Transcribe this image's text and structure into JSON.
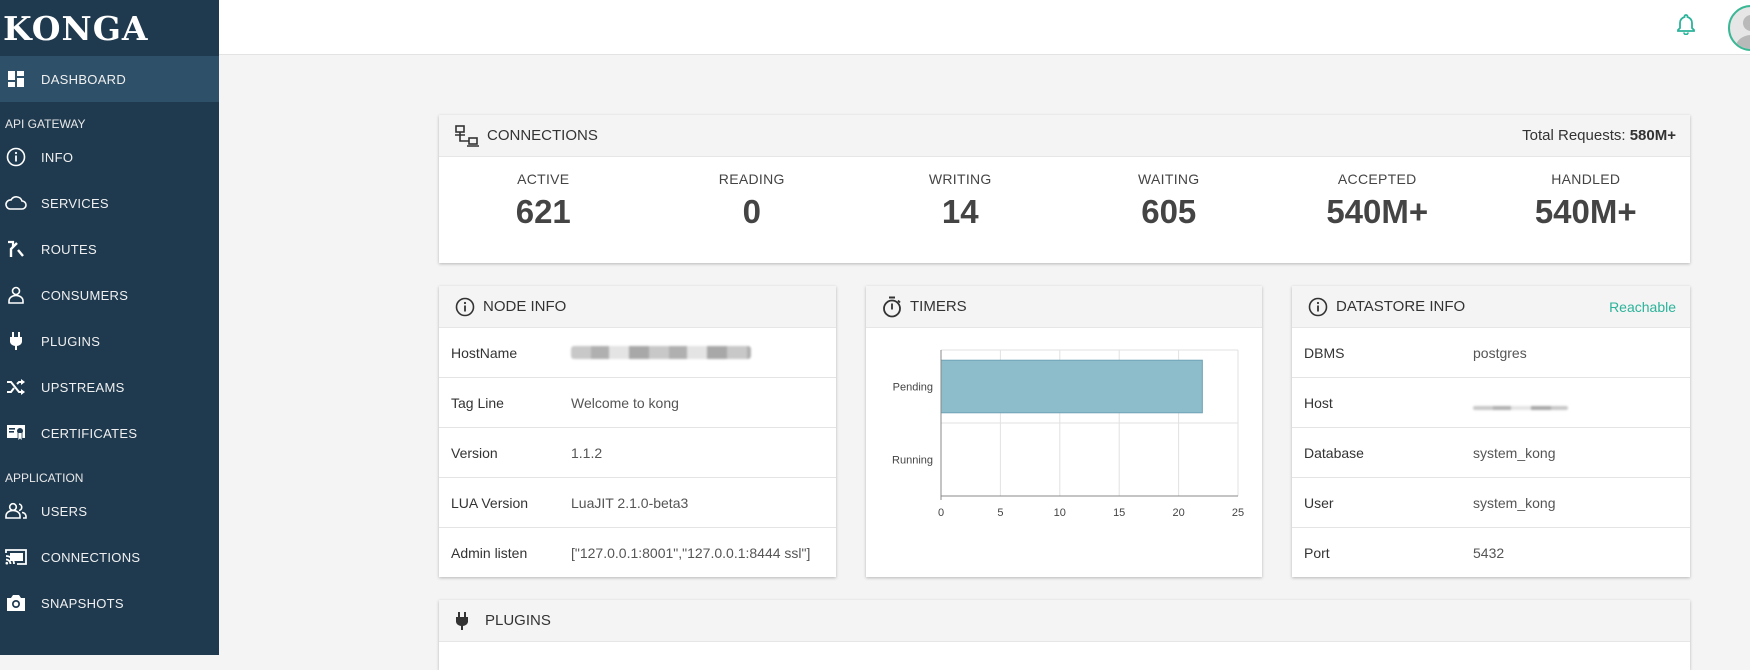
{
  "app": {
    "logo": "KONGA"
  },
  "sidebar": {
    "dashboard": "DASHBOARD",
    "section_gateway": "API GATEWAY",
    "gateway_items": [
      "INFO",
      "SERVICES",
      "ROUTES",
      "CONSUMERS",
      "PLUGINS",
      "UPSTREAMS",
      "CERTIFICATES"
    ],
    "section_application": "APPLICATION",
    "application_items": [
      "USERS",
      "CONNECTIONS",
      "SNAPSHOTS"
    ]
  },
  "connections": {
    "title": "CONNECTIONS",
    "total_label": "Total Requests:",
    "total_value": "580M+",
    "stats": [
      {
        "label": "ACTIVE",
        "value": "621"
      },
      {
        "label": "READING",
        "value": "0"
      },
      {
        "label": "WRITING",
        "value": "14"
      },
      {
        "label": "WAITING",
        "value": "605"
      },
      {
        "label": "ACCEPTED",
        "value": "540M+"
      },
      {
        "label": "HANDLED",
        "value": "540M+"
      }
    ]
  },
  "node_info": {
    "title": "NODE INFO",
    "rows": [
      {
        "key": "HostName",
        "value": ""
      },
      {
        "key": "Tag Line",
        "value": "Welcome to kong"
      },
      {
        "key": "Version",
        "value": "1.1.2"
      },
      {
        "key": "LUA Version",
        "value": "LuaJIT 2.1.0-beta3"
      },
      {
        "key": "Admin listen",
        "value": "[\"127.0.0.1:8001\",\"127.0.0.1:8444 ssl\"]"
      }
    ]
  },
  "timers": {
    "title": "TIMERS"
  },
  "datastore": {
    "title": "DATASTORE INFO",
    "status": "Reachable",
    "rows": [
      {
        "key": "DBMS",
        "value": "postgres"
      },
      {
        "key": "Host",
        "value": ""
      },
      {
        "key": "Database",
        "value": "system_kong"
      },
      {
        "key": "User",
        "value": "system_kong"
      },
      {
        "key": "Port",
        "value": "5432"
      }
    ]
  },
  "plugins": {
    "title": "PLUGINS"
  },
  "chart_data": {
    "type": "bar",
    "orientation": "horizontal",
    "categories": [
      "Pending",
      "Running"
    ],
    "values": [
      22,
      0
    ],
    "xticks": [
      "0",
      "5",
      "10",
      "15",
      "20",
      "25"
    ],
    "xlim": [
      0,
      25
    ],
    "grid": true,
    "bar_color": "#8dbccb"
  }
}
